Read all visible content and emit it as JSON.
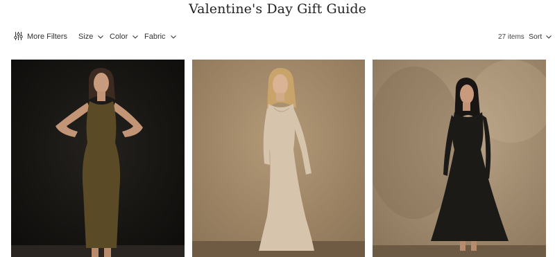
{
  "page": {
    "title": "Valentine's Day Gift Guide"
  },
  "toolbar": {
    "more_filters_label": "More Filters",
    "filters": [
      {
        "label": "Size"
      },
      {
        "label": "Color"
      },
      {
        "label": "Fabric"
      }
    ],
    "item_count": "27 items",
    "sort_label": "Sort"
  },
  "products": [
    {
      "dress_color": "#5a4a26",
      "background": "#141210",
      "icon": "product-photo"
    },
    {
      "dress_color": "#d6c4ad",
      "background": "#a48b6b",
      "icon": "product-photo"
    },
    {
      "dress_color": "#1b1a17",
      "background": "#a48f74",
      "icon": "product-photo"
    }
  ]
}
